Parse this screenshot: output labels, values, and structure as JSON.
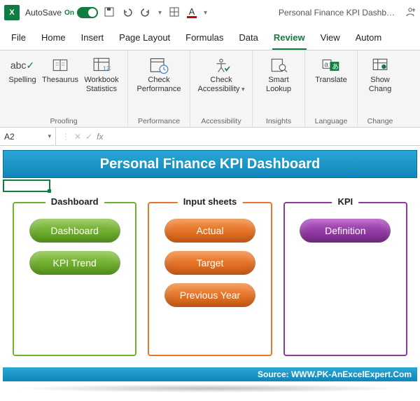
{
  "titlebar": {
    "autosave_label": "AutoSave",
    "switch_text": "On",
    "doc_title": "Personal Finance KPI Dashb…"
  },
  "tabs": {
    "file": "File",
    "home": "Home",
    "insert": "Insert",
    "page_layout": "Page Layout",
    "formulas": "Formulas",
    "data": "Data",
    "review": "Review",
    "view": "View",
    "autom": "Autom"
  },
  "ribbon": {
    "proofing": {
      "label": "Proofing",
      "spelling": "Spelling",
      "thesaurus": "Thesaurus",
      "workbook_stats": "Workbook Statistics"
    },
    "performance": {
      "label": "Performance",
      "check_performance": "Check Performance"
    },
    "accessibility": {
      "label": "Accessibility",
      "check_accessibility": "Check Accessibility"
    },
    "insights": {
      "label": "Insights",
      "smart_lookup": "Smart Lookup"
    },
    "language": {
      "label": "Language",
      "translate": "Translate"
    },
    "changes": {
      "label": "Change",
      "show_changes": "Show Chang"
    }
  },
  "formula_bar": {
    "namebox": "A2",
    "fx": "fx"
  },
  "sheet": {
    "title": "Personal Finance KPI Dashboard",
    "source": "Source: WWW.PK-AnExcelExpert.Com",
    "groups": {
      "dashboard": {
        "title": "Dashboard",
        "items": [
          "Dashboard",
          "KPI Trend"
        ]
      },
      "input": {
        "title": "Input sheets",
        "items": [
          "Actual",
          "Target",
          "Previous Year"
        ]
      },
      "kpi": {
        "title": "KPI",
        "items": [
          "Definition"
        ]
      }
    }
  }
}
